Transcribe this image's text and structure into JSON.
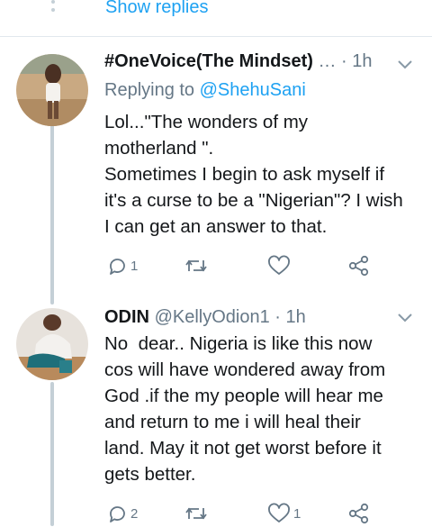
{
  "thread": {
    "show_replies_label": "Show replies"
  },
  "tweets": [
    {
      "display_name": "#OneVoice(The Mindset)",
      "ellipsis": "…",
      "separator": "·",
      "time": "1h",
      "replying_prefix": "Replying to ",
      "replying_to": "@ShehuSani",
      "text": "Lol...\"The wonders of my\nmotherland \".\nSometimes I begin to ask myself if\nit's a curse to be a \"Nigerian\"? I wish\nI can get an answer to that.",
      "reply_count": "1",
      "retweet_count": "",
      "like_count": "",
      "avatar_icon": "user-photo-avatar"
    },
    {
      "display_name": "ODIN",
      "handle": "@KellyOdion1",
      "separator": "·",
      "time": "1h",
      "text": "No  dear.. Nigeria is like this now\ncos will have wondered away from\nGod .if the my people will hear me\nand return to me i will heal their\nland. May it not get worst before it\ngets better.",
      "reply_count": "2",
      "retweet_count": "",
      "like_count": "1",
      "avatar_icon": "user-photo-avatar"
    }
  ],
  "icons": {
    "reply": "reply-icon",
    "retweet": "retweet-icon",
    "like": "heart-icon",
    "share": "share-icon",
    "chevron": "chevron-down-icon"
  },
  "colors": {
    "link": "#1da1f2",
    "secondary_text": "#657786",
    "primary_text": "#14171a",
    "divider": "#e1e8ed",
    "thread_line": "#c4cfd6"
  }
}
